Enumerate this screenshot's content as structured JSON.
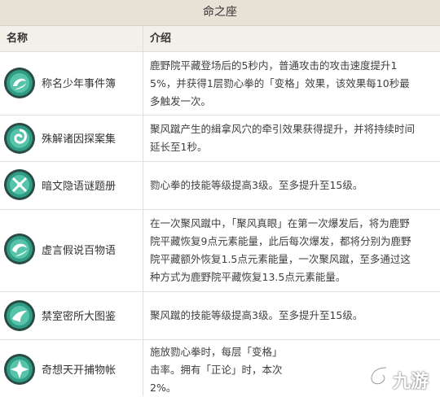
{
  "title": "命之座",
  "header": {
    "name_col": "名称",
    "desc_col": "介绍"
  },
  "rows": [
    {
      "name": "称名少年事件簿",
      "icon": "constellation-swirl-icon",
      "desc": [
        "鹿野院平藏登场后的5秒内，普通攻击的攻击速度提升1",
        "5%，并获得1层勠心拳的「变格」效果，该效果每10秒最",
        "多触发一次。"
      ]
    },
    {
      "name": "殊解诸因探案集",
      "icon": "constellation-vortex-icon",
      "desc": [
        "聚风蹴产生的緝拿风穴的牵引效果获得提升，并将持续时间",
        "延长至1秒。"
      ]
    },
    {
      "name": "暗文隐语谜题册",
      "icon": "constellation-burst-icon",
      "desc": [
        "勠心拳的技能等级提高3级。至多提升至15级。"
      ]
    },
    {
      "name": "虚言假说百物语",
      "icon": "constellation-swirl-icon",
      "desc": [
        "在一次聚风蹴中，「聚风真眼」在第一次爆发后，将为鹿野",
        "院平藏恢复9点元素能量，此后每次爆发，都将分别为鹿野",
        "院平藏额外恢复1.5点元素能量，一次聚风蹴，至多通过这",
        "种方式为鹿野院平藏恢复13.5点元素能量。"
      ]
    },
    {
      "name": "禁室密所大图鉴",
      "icon": "constellation-wave-icon",
      "desc": [
        "聚风蹴的技能等级提高3级。至多提升至15级。"
      ]
    },
    {
      "name": "奇想天开捕物帐",
      "icon": "constellation-star-icon",
      "desc": [
        "施放勠心拳时，每层「变格」",
        "击率。拥有「正论」时，本次",
        "2%。"
      ]
    }
  ],
  "watermark": "九游",
  "colors": {
    "title_bg": "#e7e1d6",
    "header_bg": "#f3efe9",
    "icon_teal": "#2f9c86",
    "icon_dark": "#28453f"
  }
}
